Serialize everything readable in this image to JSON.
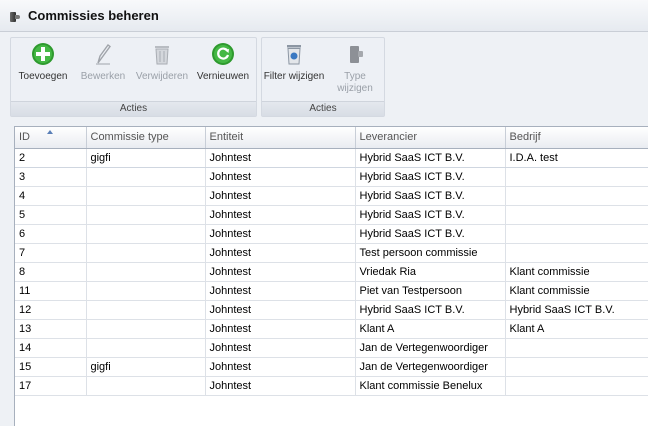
{
  "window": {
    "title": "Commissies beheren"
  },
  "ribbon": {
    "groups": [
      {
        "label": "Acties",
        "buttons": [
          {
            "label": "Toevoegen",
            "icon": "add-icon",
            "enabled": true
          },
          {
            "label": "Bewerken",
            "icon": "pencil-icon",
            "enabled": false
          },
          {
            "label": "Verwijderen",
            "icon": "trash-icon",
            "enabled": false
          },
          {
            "label": "Vernieuwen",
            "icon": "refresh-icon",
            "enabled": true
          }
        ]
      },
      {
        "label": "Acties",
        "buttons": [
          {
            "label": "Filter wijzigen",
            "icon": "filter-bin-icon",
            "enabled": true
          },
          {
            "label": "Type wijzigen",
            "icon": "type-icon",
            "enabled": false
          }
        ]
      }
    ]
  },
  "grid": {
    "columns": [
      "ID",
      "Commissie type",
      "Entiteit",
      "Leverancier",
      "Bedrijf"
    ],
    "rows": [
      [
        "2",
        "gigfi",
        "Johntest",
        "Hybrid SaaS ICT B.V.",
        "I.D.A. test"
      ],
      [
        "3",
        "",
        "Johntest",
        "Hybrid SaaS ICT B.V.",
        ""
      ],
      [
        "4",
        "",
        "Johntest",
        "Hybrid SaaS ICT B.V.",
        ""
      ],
      [
        "5",
        "",
        "Johntest",
        "Hybrid SaaS ICT B.V.",
        ""
      ],
      [
        "6",
        "",
        "Johntest",
        "Hybrid SaaS ICT B.V.",
        ""
      ],
      [
        "7",
        "",
        "Johntest",
        "Test persoon commissie",
        ""
      ],
      [
        "8",
        "",
        "Johntest",
        "Vriedak Ria",
        "Klant commissie"
      ],
      [
        "11",
        "",
        "Johntest",
        "Piet van Testpersoon",
        "Klant commissie"
      ],
      [
        "12",
        "",
        "Johntest",
        "Hybrid SaaS ICT B.V.",
        "Hybrid SaaS ICT B.V."
      ],
      [
        "13",
        "",
        "Johntest",
        "Klant A",
        "Klant A"
      ],
      [
        "14",
        "",
        "Johntest",
        "Jan de Vertegenwoordiger",
        ""
      ],
      [
        "15",
        "gigfi",
        "Johntest",
        "Jan de Vertegenwoordiger",
        ""
      ],
      [
        "17",
        "",
        "Johntest",
        "Klant commissie Benelux",
        ""
      ]
    ]
  }
}
